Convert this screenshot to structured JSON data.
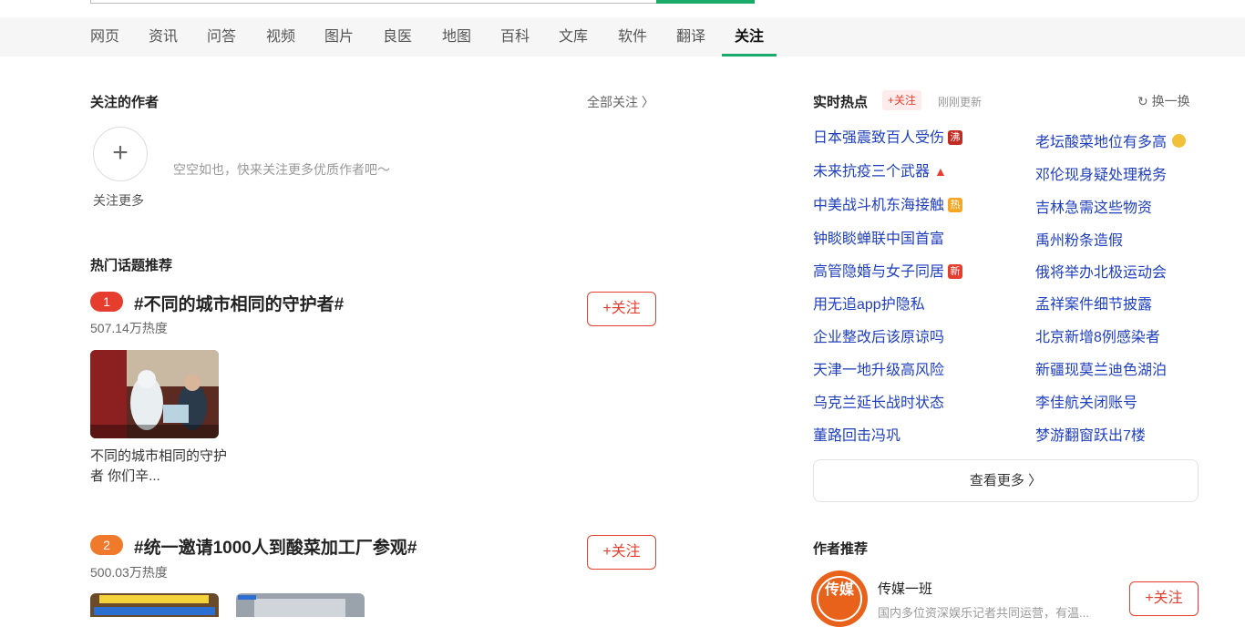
{
  "nav": {
    "tabs": [
      "网页",
      "资讯",
      "问答",
      "视频",
      "图片",
      "良医",
      "地图",
      "百科",
      "文库",
      "软件",
      "翻译",
      "关注"
    ],
    "active": "关注"
  },
  "followed_authors": {
    "title": "关注的作者",
    "all_link": "全部关注 〉",
    "plus": "+",
    "empty_text": "空空如也，快来关注更多优质作者吧～",
    "follow_more": "关注更多"
  },
  "hot_topics": {
    "title": "热门话题推荐",
    "items": [
      {
        "rank": "1",
        "title": "#不同的城市相同的守护者#",
        "heat": "507.14万热度",
        "follow": "+关注",
        "caption": "不同的城市相同的守护者 你们辛...",
        "rank_color": "#e53e2f"
      },
      {
        "rank": "2",
        "title": "#统一邀请1000人到酸菜加工厂参观#",
        "heat": "500.03万热度",
        "follow": "+关注",
        "rank_color": "#f07a2c"
      }
    ]
  },
  "realtime": {
    "title": "实时热点",
    "follow": "+关注",
    "updated": "刚刚更新",
    "refresh": "换一换",
    "left": [
      {
        "text": "日本强震致百人受伤",
        "badge": "沸",
        "badge_color": "#c02b22"
      },
      {
        "text": "未来抗疫三个武器",
        "badge": "up",
        "badge_color": "#e53e2f"
      },
      {
        "text": "中美战斗机东海接触",
        "badge": "热",
        "badge_color": "#f5a623"
      },
      {
        "text": "钟睒睒蝉联中国首富",
        "badge": ""
      },
      {
        "text": "高管隐婚与女子同居",
        "badge": "新",
        "badge_color": "#e53e2f"
      },
      {
        "text": "用无追app护隐私",
        "badge": ""
      },
      {
        "text": "企业整改后该原谅吗",
        "badge": ""
      },
      {
        "text": "天津一地升级高风险",
        "badge": ""
      },
      {
        "text": "乌克兰延长战时状态",
        "badge": ""
      },
      {
        "text": "董路回击冯巩",
        "badge": ""
      }
    ],
    "right": [
      {
        "text": "老坛酸菜地位有多高",
        "badge": "emoji"
      },
      {
        "text": "邓伦现身疑处理税务",
        "badge": ""
      },
      {
        "text": "吉林急需这些物资",
        "badge": ""
      },
      {
        "text": "禹州粉条造假",
        "badge": ""
      },
      {
        "text": "俄将举办北极运动会",
        "badge": ""
      },
      {
        "text": "孟祥案件细节披露",
        "badge": ""
      },
      {
        "text": "北京新增8例感染者",
        "badge": ""
      },
      {
        "text": "新疆现莫兰迪色湖泊",
        "badge": ""
      },
      {
        "text": "李佳航关闭账号",
        "badge": ""
      },
      {
        "text": "梦游翻窗跃出7楼",
        "badge": ""
      }
    ],
    "see_more": "查看更多 〉"
  },
  "author_rec": {
    "title": "作者推荐",
    "name": "传媒一班",
    "desc": "国内多位资深娱乐记者共同运营，有温...",
    "follow": "+关注",
    "avatar_text": "传媒"
  },
  "colors": {
    "accent": "#1aab6b",
    "link": "#1f3fbf",
    "red": "#e53e2f"
  }
}
